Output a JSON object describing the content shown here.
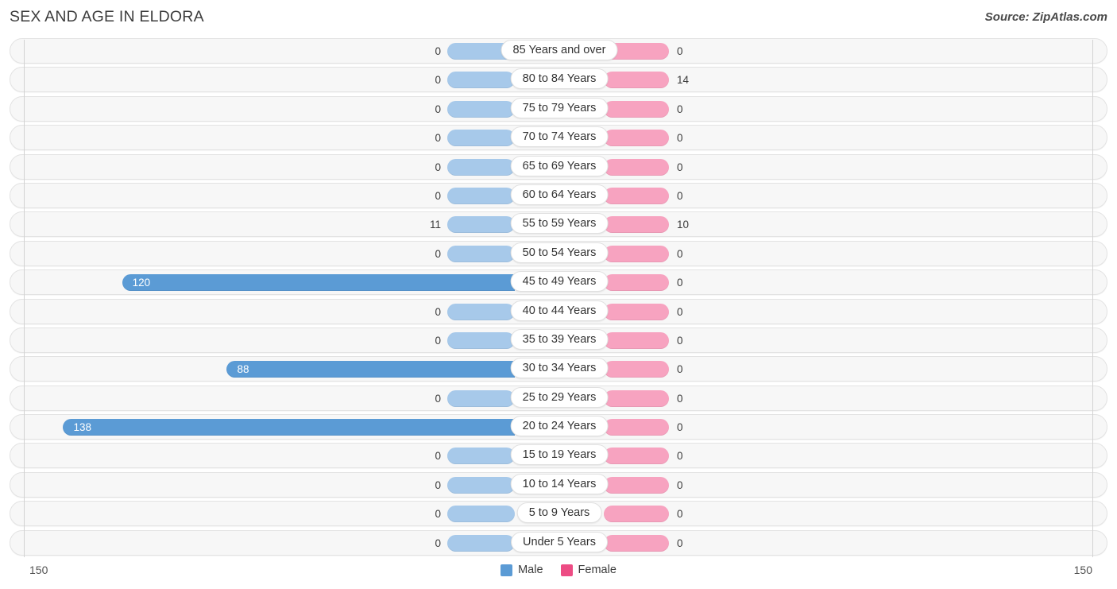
{
  "header": {
    "title": "SEX AND AGE IN ELDORA",
    "source": "Source: ZipAtlas.com"
  },
  "footer": {
    "axis_left": "150",
    "axis_right": "150",
    "legend": [
      {
        "label": "Male",
        "color": "#5b9bd5"
      },
      {
        "label": "Female",
        "color": "#ed4c84"
      }
    ]
  },
  "chart_data": {
    "type": "bar",
    "subtype": "population-pyramid",
    "title": "SEX AND AGE IN ELDORA",
    "xlabel": "",
    "ylabel": "",
    "xlim": [
      -150,
      150
    ],
    "axis_max": 150,
    "grid": false,
    "legend_position": "bottom-center",
    "categories": [
      "85 Years and over",
      "80 to 84 Years",
      "75 to 79 Years",
      "70 to 74 Years",
      "65 to 69 Years",
      "60 to 64 Years",
      "55 to 59 Years",
      "50 to 54 Years",
      "45 to 49 Years",
      "40 to 44 Years",
      "35 to 39 Years",
      "30 to 34 Years",
      "25 to 29 Years",
      "20 to 24 Years",
      "15 to 19 Years",
      "10 to 14 Years",
      "5 to 9 Years",
      "Under 5 Years"
    ],
    "series": [
      {
        "name": "Male",
        "color": "#5b9bd5",
        "values": [
          0,
          0,
          0,
          0,
          0,
          0,
          11,
          0,
          120,
          0,
          0,
          88,
          0,
          138,
          0,
          0,
          0,
          0
        ]
      },
      {
        "name": "Female",
        "color": "#ed4c84",
        "values": [
          0,
          14,
          0,
          0,
          0,
          0,
          10,
          0,
          0,
          0,
          0,
          0,
          0,
          0,
          0,
          0,
          0,
          0
        ]
      }
    ],
    "rows": [
      {
        "label": "85 Years and over",
        "male": "0",
        "female": "0"
      },
      {
        "label": "80 to 84 Years",
        "male": "0",
        "female": "14"
      },
      {
        "label": "75 to 79 Years",
        "male": "0",
        "female": "0"
      },
      {
        "label": "70 to 74 Years",
        "male": "0",
        "female": "0"
      },
      {
        "label": "65 to 69 Years",
        "male": "0",
        "female": "0"
      },
      {
        "label": "60 to 64 Years",
        "male": "0",
        "female": "0"
      },
      {
        "label": "55 to 59 Years",
        "male": "11",
        "female": "10"
      },
      {
        "label": "50 to 54 Years",
        "male": "0",
        "female": "0"
      },
      {
        "label": "45 to 49 Years",
        "male": "120",
        "female": "0"
      },
      {
        "label": "40 to 44 Years",
        "male": "0",
        "female": "0"
      },
      {
        "label": "35 to 39 Years",
        "male": "0",
        "female": "0"
      },
      {
        "label": "30 to 34 Years",
        "male": "88",
        "female": "0"
      },
      {
        "label": "25 to 29 Years",
        "male": "0",
        "female": "0"
      },
      {
        "label": "20 to 24 Years",
        "male": "138",
        "female": "0"
      },
      {
        "label": "15 to 19 Years",
        "male": "0",
        "female": "0"
      },
      {
        "label": "10 to 14 Years",
        "male": "0",
        "female": "0"
      },
      {
        "label": "5 to 9 Years",
        "male": "0",
        "female": "0"
      },
      {
        "label": "Under 5 Years",
        "male": "0",
        "female": "0"
      }
    ]
  }
}
